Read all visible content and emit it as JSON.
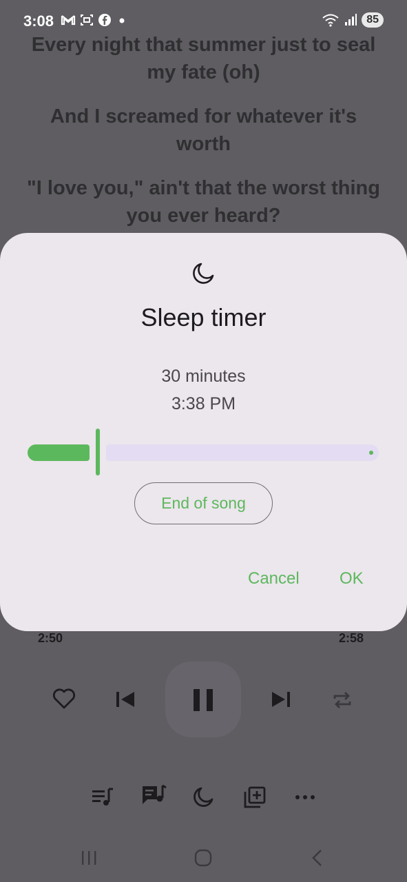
{
  "status_bar": {
    "time": "3:08",
    "battery": "85",
    "notification_icons": [
      "gmail-icon",
      "screenshot-icon",
      "facebook-icon",
      "dot-icon"
    ]
  },
  "lyrics": [
    "Every night that summer just to seal my fate (oh)",
    "And I screamed for whatever it's worth",
    "\"I love you,\" ain't that the worst thing you ever heard?"
  ],
  "dialog": {
    "title": "Sleep timer",
    "minutes": "30 minutes",
    "end_time": "3:38 PM",
    "slider_fraction": 0.2,
    "end_of_song_label": "End of song",
    "cancel_label": "Cancel",
    "ok_label": "OK"
  },
  "player": {
    "elapsed": "2:50",
    "duration": "2:58"
  },
  "colors": {
    "accent": "#5cb85c",
    "dialog_bg": "#ece6ed",
    "scrim": "#5f5d61"
  }
}
